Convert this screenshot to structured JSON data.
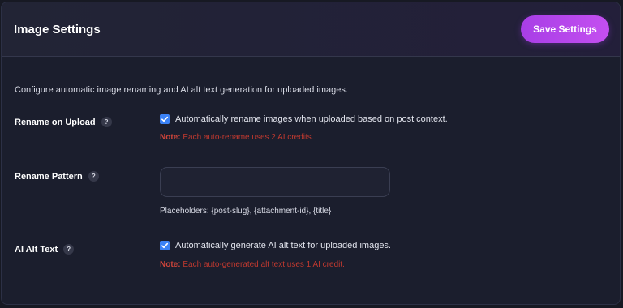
{
  "header": {
    "title": "Image Settings",
    "save_label": "Save Settings"
  },
  "description": "Configure automatic image renaming and AI alt text generation for uploaded images.",
  "colors": {
    "accent": "#b847ec",
    "checkbox": "#3b82f6",
    "note": "#c0392f",
    "background": "#1b1e2d"
  },
  "rename_on_upload": {
    "label": "Rename on Upload",
    "help": "?",
    "checkbox_label": "Automatically rename images when uploaded based on post context.",
    "checked": true,
    "note_prefix": "Note:",
    "note_text": "Each auto-rename uses 2 AI credits."
  },
  "rename_pattern": {
    "label": "Rename Pattern",
    "help": "?",
    "value": "",
    "helper": "Placeholders: {post-slug}, {attachment-id}, {title}"
  },
  "ai_alt_text": {
    "label": "AI Alt Text",
    "help": "?",
    "checkbox_label": "Automatically generate AI alt text for uploaded images.",
    "checked": true,
    "note_prefix": "Note:",
    "note_text": "Each auto-generated alt text uses 1 AI credit."
  }
}
